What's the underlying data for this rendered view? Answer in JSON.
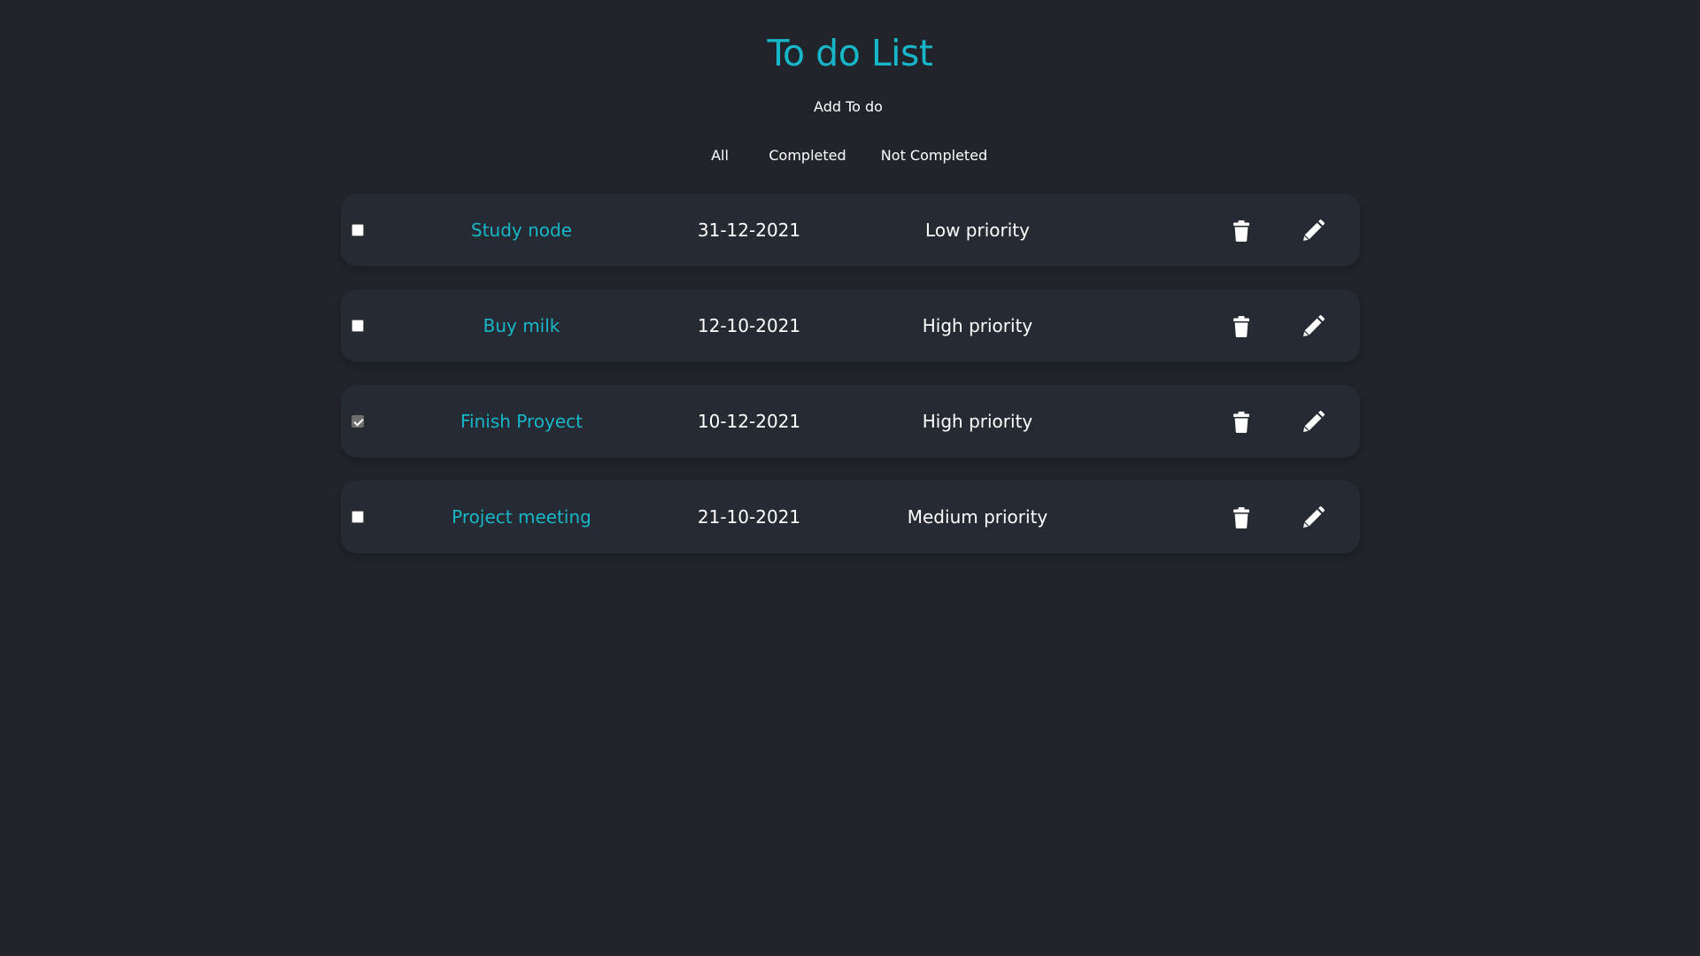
{
  "app": {
    "title": "To do List",
    "add_label": "Add To do",
    "accent_color": "#17b7c9",
    "background_color": "#21252b"
  },
  "filters": [
    {
      "label": "All"
    },
    {
      "label": "Completed"
    },
    {
      "label": "Not Completed"
    }
  ],
  "todos": [
    {
      "name": "Study node",
      "date": "31-12-2021",
      "priority": "Low priority",
      "completed": false
    },
    {
      "name": "Buy milk",
      "date": "12-10-2021",
      "priority": "High priority",
      "completed": false
    },
    {
      "name": "Finish Proyect",
      "date": "10-12-2021",
      "priority": "High priority",
      "completed": true
    },
    {
      "name": "Project meeting",
      "date": "21-10-2021",
      "priority": "Medium priority",
      "completed": false
    }
  ],
  "icons": {
    "delete": "trash-icon",
    "edit": "pencil-icon"
  }
}
